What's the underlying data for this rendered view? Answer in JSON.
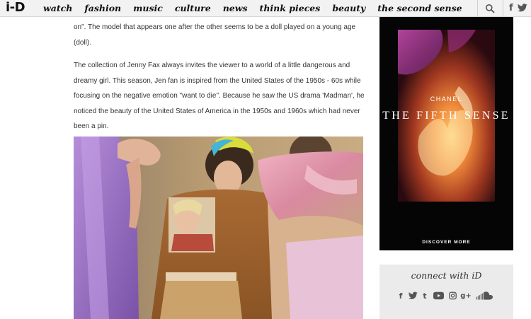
{
  "header": {
    "logo_text": "i-D",
    "nav": [
      "watch",
      "fashion",
      "music",
      "culture",
      "news",
      "think pieces",
      "beauty",
      "the second sense"
    ],
    "icons": [
      "search-icon",
      "facebook-icon",
      "twitter-icon"
    ],
    "facebook_glyph": "f"
  },
  "article": {
    "paragraph_1": "on\". The model that appears one after the other seems to be a doll played on a young age (doll).",
    "paragraph_2": "The collection of Jenny Fax always invites the viewer to a world of a little dangerous and dreamy girl. This season, Jen fan is inspired from the United States of the 1950s - 60s while focusing on the negative emotion \"want to die\". Because he saw the US drama 'Madman', he noticed the beauty of the United States of America in the 1950s and 1960s which had never been a pin."
  },
  "ad": {
    "brand": "CHANEL",
    "headline": "THE FIFTH SENSE",
    "cta": "DISCOVER MORE"
  },
  "connect": {
    "title": "connect with iD",
    "icons": [
      "facebook-icon",
      "twitter-icon",
      "tumblr-icon",
      "youtube-icon",
      "instagram-icon",
      "google-plus-icon",
      "soundcloud-icon"
    ],
    "glyphs": {
      "facebook": "f",
      "tumblr": "t",
      "google_plus": "g+"
    }
  },
  "colors": {
    "nav_bg": "#f2f2f2",
    "ad_bg": "#050505",
    "connect_bg": "#ebebeb",
    "text": "#333333"
  }
}
